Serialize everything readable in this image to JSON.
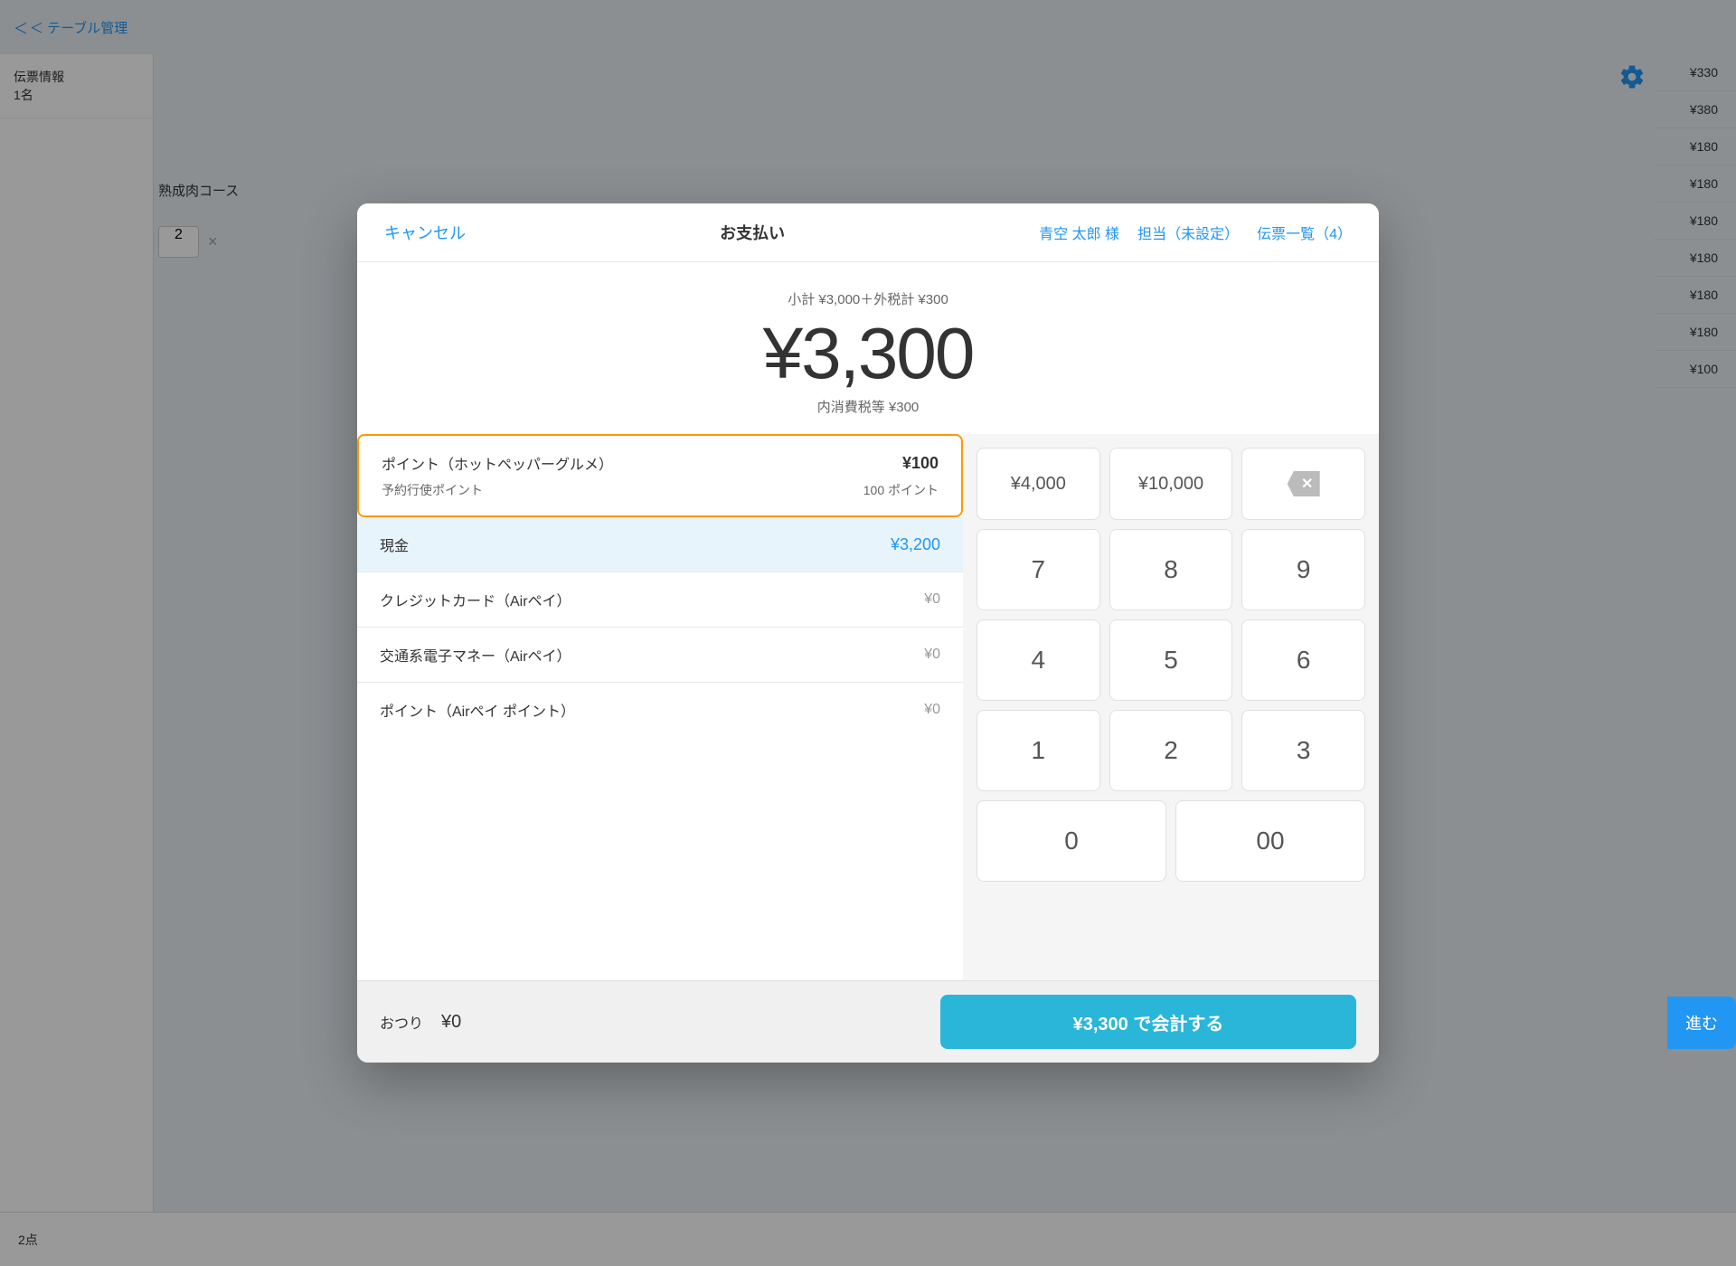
{
  "bg": {
    "nav_back": "＜ テーブル管理",
    "sidebar": {
      "item1_line1": "伝票情報",
      "item1_line2": "1名"
    },
    "course_label": "熟成肉コース",
    "qty": "2",
    "bottom_count": "2点",
    "prices": [
      "¥330",
      "¥380",
      "¥180",
      "¥180",
      "¥180",
      "¥180",
      "¥180",
      "¥180",
      "¥100"
    ]
  },
  "header": {
    "cancel": "キャンセル",
    "title": "お支払い",
    "customer": "青空 太郎 様",
    "staff": "担当（未設定）",
    "receipt": "伝票一覧（4）"
  },
  "amount": {
    "subtotal_label": "小計 ¥3,000＋外税計 ¥300",
    "main": "¥3,300",
    "tax_label": "内消費税等 ¥300"
  },
  "payment_methods": {
    "point_label": "ポイント（ホットペッパーグルメ）",
    "point_amount": "¥100",
    "point_sub_label": "予約行使ポイント",
    "point_sub_value": "100 ポイント",
    "cash_label": "現金",
    "cash_amount": "¥3,200",
    "credit_label": "クレジットカード（Airペイ）",
    "credit_amount": "¥0",
    "transit_label": "交通系電子マネー（Airペイ）",
    "transit_amount": "¥0",
    "airpay_label": "ポイント（Airペイ ポイント）",
    "airpay_amount": "¥0"
  },
  "numpad": {
    "quick1": "¥4,000",
    "quick2": "¥10,000",
    "delete": "⌫",
    "keys": [
      "7",
      "8",
      "9",
      "4",
      "5",
      "6",
      "1",
      "2",
      "3",
      "0",
      "00"
    ]
  },
  "footer": {
    "change_label": "おつり",
    "change_amount": "¥0",
    "pay_button": "¥3,300 で会計する",
    "next_button": "進む"
  }
}
